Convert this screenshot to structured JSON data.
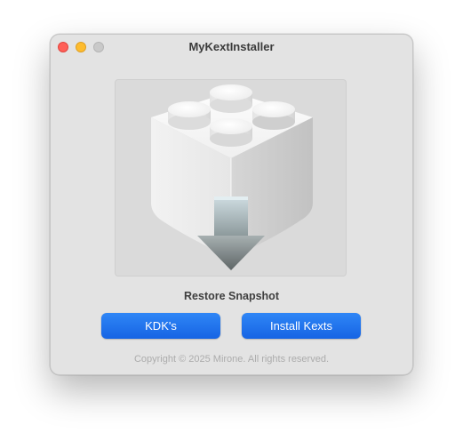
{
  "window": {
    "title": "MyKextInstaller",
    "controls": [
      "close",
      "minimize",
      "zoom"
    ]
  },
  "main": {
    "icon": "kext-install-icon",
    "caption": "Restore Snapshot",
    "buttons": {
      "kdk_label": "KDK's",
      "install_label": "Install Kexts"
    },
    "copyright": "Copyright © 2025 Mirone. All rights reserved."
  },
  "colors": {
    "accent": "#1a6ff0",
    "close": "#ff5f57",
    "minimize": "#febc2e",
    "zoom_disabled": "#c9c9c9",
    "window_bg": "#e3e3e3"
  }
}
